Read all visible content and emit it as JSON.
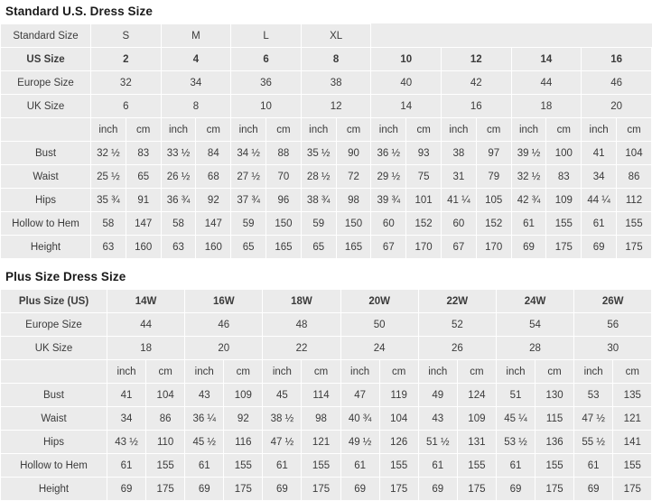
{
  "standard": {
    "title": "Standard U.S. Dress Size",
    "rows": {
      "standard_size_label": "Standard Size",
      "us_size_label": "US Size",
      "europe_size_label": "Europe Size",
      "uk_size_label": "UK Size"
    },
    "groups": [
      "S",
      "M",
      "L",
      "XL"
    ],
    "us_sizes": [
      "2",
      "4",
      "6",
      "8",
      "10",
      "12",
      "14",
      "16"
    ],
    "europe_sizes": [
      "32",
      "34",
      "36",
      "38",
      "40",
      "42",
      "44",
      "46"
    ],
    "uk_sizes": [
      "6",
      "8",
      "10",
      "12",
      "14",
      "16",
      "18",
      "20"
    ],
    "unit_inch": "inch",
    "unit_cm": "cm",
    "measure_rows": [
      {
        "label": "Bust",
        "values": [
          "32 ½",
          "83",
          "33 ½",
          "84",
          "34 ½",
          "88",
          "35 ½",
          "90",
          "36 ½",
          "93",
          "38",
          "97",
          "39 ½",
          "100",
          "41",
          "104"
        ]
      },
      {
        "label": "Waist",
        "values": [
          "25 ½",
          "65",
          "26 ½",
          "68",
          "27 ½",
          "70",
          "28 ½",
          "72",
          "29 ½",
          "75",
          "31",
          "79",
          "32 ½",
          "83",
          "34",
          "86"
        ]
      },
      {
        "label": "Hips",
        "values": [
          "35 ¾",
          "91",
          "36 ¾",
          "92",
          "37 ¾",
          "96",
          "38 ¾",
          "98",
          "39 ¾",
          "101",
          "41 ¼",
          "105",
          "42 ¾",
          "109",
          "44 ¼",
          "112"
        ]
      },
      {
        "label": "Hollow to Hem",
        "values": [
          "58",
          "147",
          "58",
          "147",
          "59",
          "150",
          "59",
          "150",
          "60",
          "152",
          "60",
          "152",
          "61",
          "155",
          "61",
          "155"
        ]
      },
      {
        "label": "Height",
        "values": [
          "63",
          "160",
          "63",
          "160",
          "65",
          "165",
          "65",
          "165",
          "67",
          "170",
          "67",
          "170",
          "69",
          "175",
          "69",
          "175"
        ]
      }
    ]
  },
  "plus": {
    "title": "Plus Size Dress Size",
    "rows": {
      "plus_size_label": "Plus Size (US)",
      "europe_size_label": "Europe Size",
      "uk_size_label": "UK Size"
    },
    "plus_sizes": [
      "14W",
      "16W",
      "18W",
      "20W",
      "22W",
      "24W",
      "26W"
    ],
    "europe_sizes": [
      "44",
      "46",
      "48",
      "50",
      "52",
      "54",
      "56"
    ],
    "uk_sizes": [
      "18",
      "20",
      "22",
      "24",
      "26",
      "28",
      "30"
    ],
    "unit_inch": "inch",
    "unit_cm": "cm",
    "measure_rows": [
      {
        "label": "Bust",
        "values": [
          "41",
          "104",
          "43",
          "109",
          "45",
          "114",
          "47",
          "119",
          "49",
          "124",
          "51",
          "130",
          "53",
          "135"
        ]
      },
      {
        "label": "Waist",
        "values": [
          "34",
          "86",
          "36 ¼",
          "92",
          "38 ½",
          "98",
          "40 ¾",
          "104",
          "43",
          "109",
          "45 ¼",
          "115",
          "47 ½",
          "121"
        ]
      },
      {
        "label": "Hips",
        "values": [
          "43 ½",
          "110",
          "45 ½",
          "116",
          "47 ½",
          "121",
          "49 ½",
          "126",
          "51 ½",
          "131",
          "53 ½",
          "136",
          "55 ½",
          "141"
        ]
      },
      {
        "label": "Hollow to Hem",
        "values": [
          "61",
          "155",
          "61",
          "155",
          "61",
          "155",
          "61",
          "155",
          "61",
          "155",
          "61",
          "155",
          "61",
          "155"
        ]
      },
      {
        "label": "Height",
        "values": [
          "69",
          "175",
          "69",
          "175",
          "69",
          "175",
          "69",
          "175",
          "69",
          "175",
          "69",
          "175",
          "69",
          "175"
        ]
      }
    ]
  },
  "colors": {
    "cell_bg": "#ebebeb",
    "grid": "#ffffff",
    "text": "#3b3b3b",
    "title": "#1a1a1a"
  }
}
